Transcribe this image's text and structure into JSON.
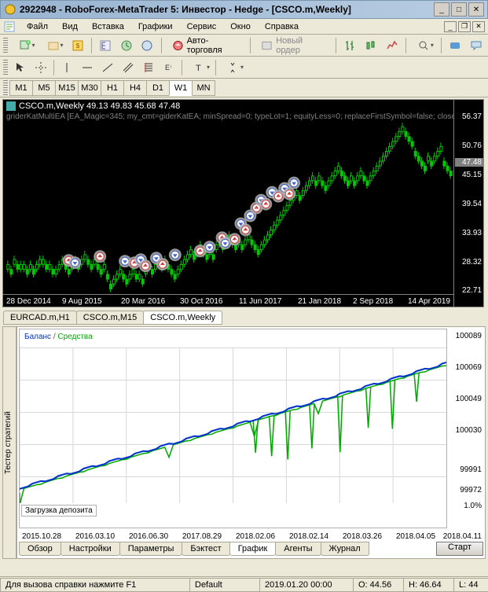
{
  "title": "2922948 - RoboForex-MetaTrader 5: Инвестор - Hedge - [CSCO.m,Weekly]",
  "menu": {
    "file": "Файл",
    "view": "Вид",
    "insert": "Вставка",
    "charts": "Графики",
    "service": "Сервис",
    "window": "Окно",
    "help": "Справка"
  },
  "toolbar": {
    "autotrade": "Авто-торговля",
    "neworder": "Новый ордер"
  },
  "timeframes": [
    "M1",
    "M5",
    "M15",
    "M30",
    "H1",
    "H4",
    "D1",
    "W1",
    "MN"
  ],
  "tf_active": "W1",
  "chart": {
    "title": "CSCO.m,Weekly  49.13 49.83 45.68 47.48",
    "ea": "griderKatMultiEA [EA_Magic=345; my_cmt=giderKatEA; minSpread=0; typeLot=1; equityLess=0; replaceFirstSymbol=false; closeAtT",
    "ylabels": [
      "56.37",
      "50.76",
      "47.48",
      "45.15",
      "39.54",
      "33.93",
      "28.32",
      "22.71"
    ],
    "ycurrent": "47.48",
    "xlabels": [
      "28 Dec 2014",
      "9 Aug 2015",
      "20 Mar 2016",
      "30 Oct 2016",
      "11 Jun 2017",
      "21 Jan 2018",
      "2 Sep 2018",
      "14 Apr 2019"
    ]
  },
  "chart_tabs": [
    "EURCAD.m,H1",
    "CSCO.m,M15",
    "CSCO.m,Weekly"
  ],
  "chart_tab_active": "CSCO.m,Weekly",
  "tester": {
    "sidetab": "Тестер стратегий",
    "legend_balance": "Баланс",
    "legend_equity": "Средства",
    "ylabels": [
      "100089",
      "100069",
      "100049",
      "100030",
      "99991",
      "99972"
    ],
    "pct_labels": [
      "1.0%"
    ],
    "loading": "Загрузка депозита",
    "xlabels": [
      "2015.10.28",
      "2016.03.10",
      "2016.06.30",
      "2017.08.29",
      "2018.02.06",
      "2018.02.14",
      "2018.03.26",
      "2018.04.05",
      "2018.04.11"
    ],
    "tabs": [
      "Обзор",
      "Настройки",
      "Параметры",
      "Бэктест",
      "График",
      "Агенты",
      "Журнал"
    ],
    "tab_active": "График",
    "start": "Старт"
  },
  "status": {
    "help": "Для вызова справки нажмите F1",
    "profile": "Default",
    "date": "2019.01.20 00:00",
    "open": "O: 44.56",
    "high": "H: 46.64",
    "low": "L: 44"
  },
  "chart_data": {
    "type": "candlestick",
    "title": "CSCO.m Weekly",
    "ylim": [
      22,
      57
    ],
    "price_axis": [
      56.37,
      50.76,
      47.48,
      45.15,
      39.54,
      33.93,
      28.32,
      22.71
    ],
    "time_axis": [
      "28 Dec 2014",
      "9 Aug 2015",
      "20 Mar 2016",
      "30 Oct 2016",
      "11 Jun 2017",
      "21 Jan 2018",
      "2 Sep 2018",
      "14 Apr 2019"
    ],
    "note": "Approx weekly OHLC values read from pixels (start,end,step roughly uniform).",
    "candles_approx": [
      28,
      27,
      29,
      28,
      28,
      28,
      27,
      28,
      27,
      28,
      29,
      29,
      28,
      28,
      27,
      27,
      28,
      29,
      28,
      27,
      28,
      29,
      28,
      29,
      30,
      29,
      28,
      29,
      28,
      27,
      28,
      26,
      24,
      25,
      26,
      27,
      26,
      25,
      26,
      27,
      26,
      26,
      25,
      27,
      28,
      27,
      28,
      29,
      28,
      29,
      28,
      27,
      26,
      27,
      28,
      29,
      30,
      31,
      30,
      31,
      32,
      31,
      30,
      31,
      30,
      32,
      33,
      32,
      33,
      34,
      33,
      32,
      33,
      32,
      33,
      34,
      33,
      32,
      31,
      32,
      33,
      34,
      35,
      36,
      37,
      38,
      39,
      40,
      41,
      42,
      43,
      42,
      43,
      44,
      45,
      46,
      45,
      46,
      45,
      44,
      45,
      46,
      47,
      48,
      47,
      46,
      45,
      46,
      45,
      46,
      47,
      46,
      45,
      46,
      47,
      48,
      49,
      50,
      51,
      52,
      53,
      54,
      55,
      56,
      55,
      54,
      53,
      51,
      50,
      49,
      48,
      50,
      49,
      50,
      51,
      52,
      49,
      48,
      47
    ],
    "equity_chart": {
      "type": "line",
      "series": [
        {
          "name": "Баланс",
          "color": "#0033cc"
        },
        {
          "name": "Средства",
          "color": "#00aa00"
        }
      ],
      "ylim": [
        99972,
        100089
      ],
      "xlabels": [
        "2015.10.28",
        "2016.03.10",
        "2016.06.30",
        "2017.08.29",
        "2018.02.06",
        "2018.02.14",
        "2018.03.26",
        "2018.04.05",
        "2018.04.11"
      ]
    }
  }
}
